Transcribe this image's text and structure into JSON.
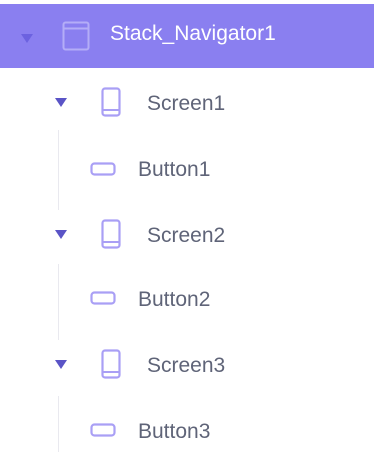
{
  "colors": {
    "selected_background": "#8a7ff0",
    "icon_accent": "#a99ff5",
    "caret": "#5a54c6",
    "text": "#5f6478"
  },
  "tree": {
    "root": {
      "label": "Stack_Navigator1",
      "icon": "window-icon",
      "expanded": true,
      "selected": true
    },
    "screens": [
      {
        "label": "Screen1",
        "icon": "phone-icon",
        "expanded": true,
        "child": {
          "label": "Button1",
          "icon": "button-icon"
        }
      },
      {
        "label": "Screen2",
        "icon": "phone-icon",
        "expanded": true,
        "child": {
          "label": "Button2",
          "icon": "button-icon"
        }
      },
      {
        "label": "Screen3",
        "icon": "phone-icon",
        "expanded": true,
        "child": {
          "label": "Button3",
          "icon": "button-icon"
        }
      }
    ]
  }
}
